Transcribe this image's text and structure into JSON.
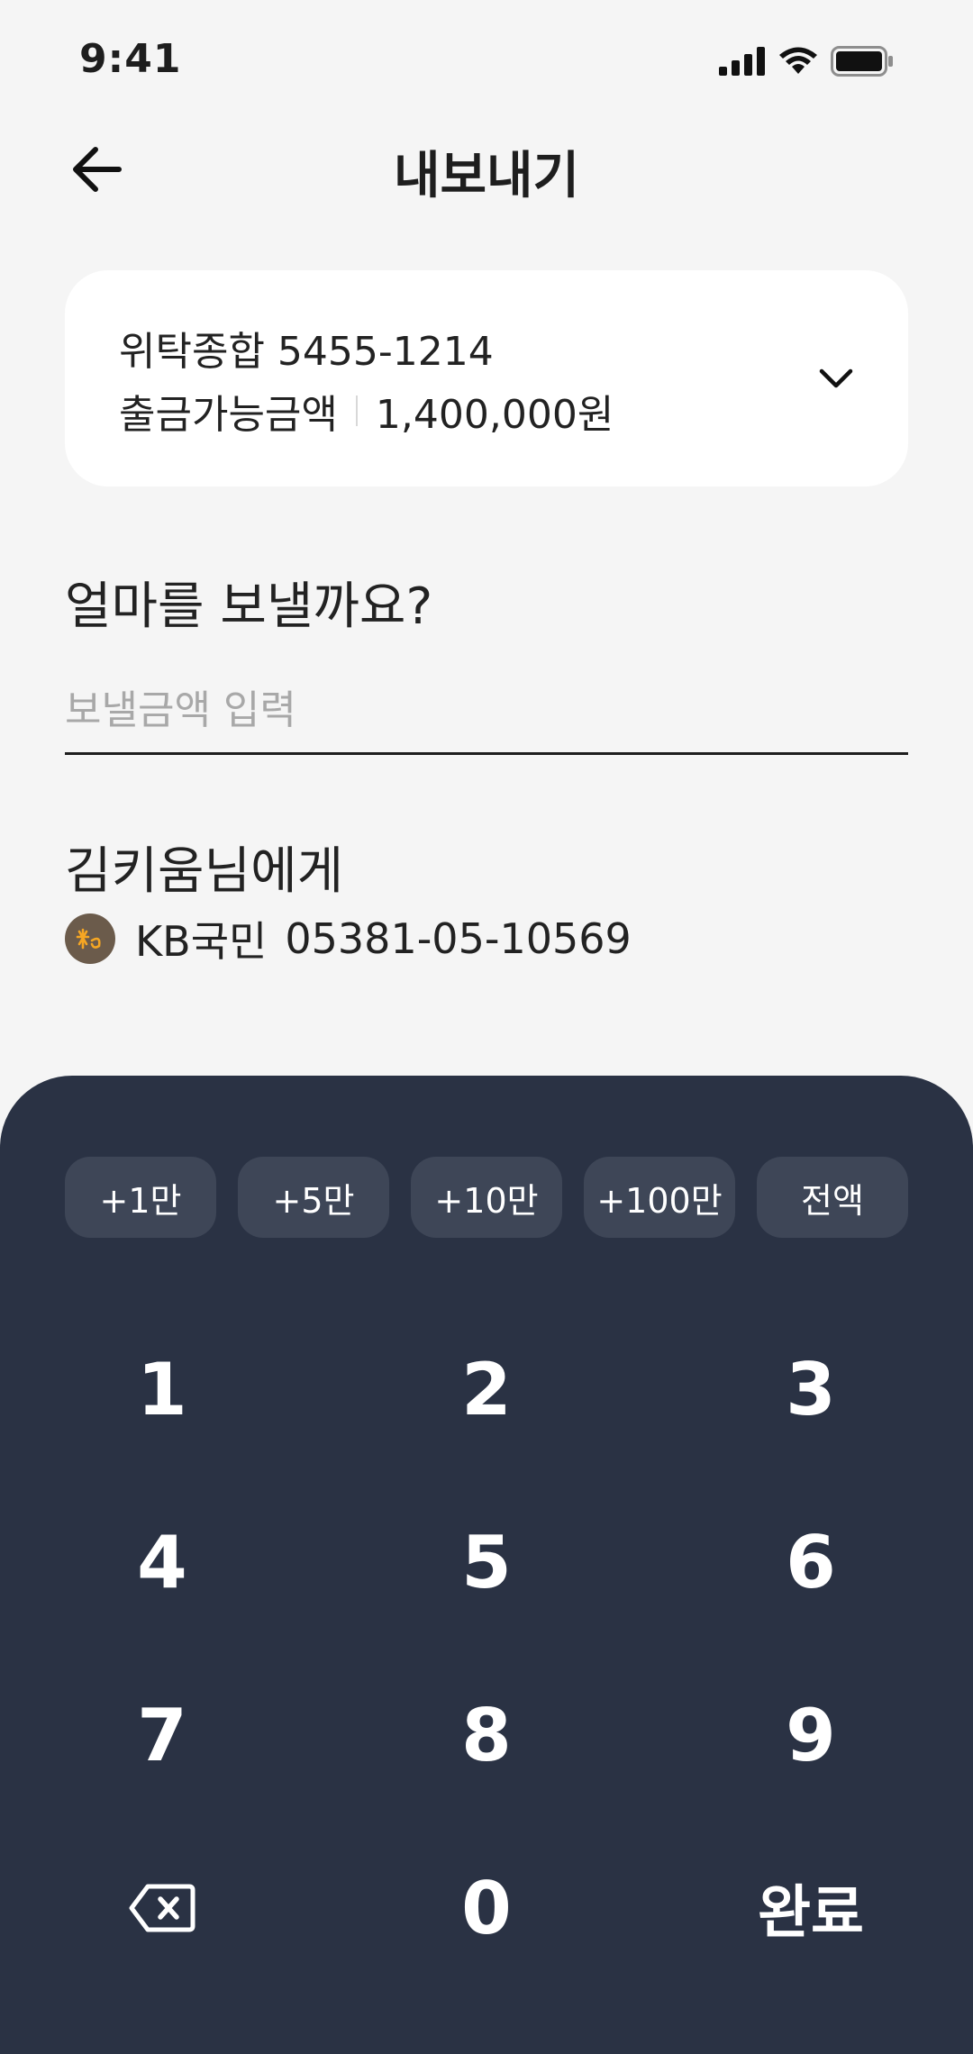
{
  "status_bar": {
    "time": "9:41"
  },
  "header": {
    "title": "내보내기"
  },
  "account": {
    "name": "위탁종합 5455-1214",
    "balance_label": "출금가능금액",
    "balance_value": "1,400,000원"
  },
  "amount": {
    "question": "얼마를 보낼까요?",
    "placeholder": "보낼금액 입력"
  },
  "recipient": {
    "name": "김키움님에게",
    "bank": "KB국민",
    "account_number": "05381-05-10569"
  },
  "quick_amounts": [
    "+1만",
    "+5만",
    "+10만",
    "+100만",
    "전액"
  ],
  "keypad": {
    "keys": [
      "1",
      "2",
      "3",
      "4",
      "5",
      "6",
      "7",
      "8",
      "9"
    ],
    "zero": "0",
    "done": "완료"
  },
  "colors": {
    "background": "#f5f5f5",
    "keypad_bg": "#2a3244",
    "chip_bg": "#3e4657",
    "bank_logo": "#6b5b4b",
    "bank_logo_mark": "#f5a623"
  }
}
